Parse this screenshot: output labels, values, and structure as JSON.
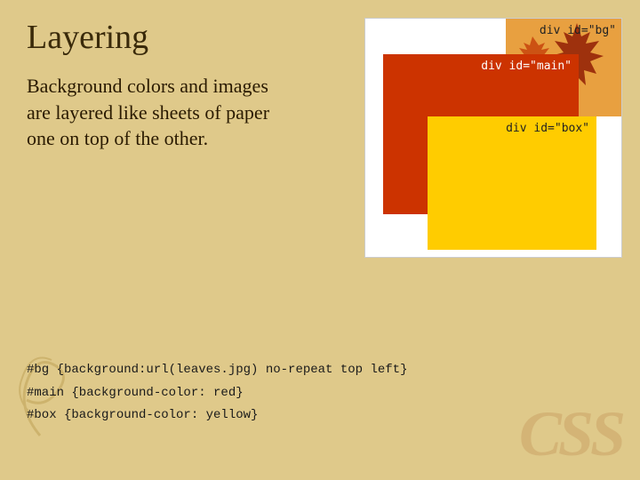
{
  "page": {
    "title": "Layering",
    "description": "Background colors and images are layered like sheets of paper one on top of the other.",
    "bg_color": "#dfc98a"
  },
  "diagram": {
    "div_bg_label": "div id=\"bg\"",
    "div_main_label": "div id=\"main\"",
    "div_box_label": "div id=\"box\""
  },
  "code": {
    "line1": "#bg {background:url(leaves.jpg) no-repeat top left}",
    "line2": "#main {background-color: red}",
    "line3": "#box {background-color: yellow}"
  },
  "watermark": {
    "text": "CSS"
  }
}
